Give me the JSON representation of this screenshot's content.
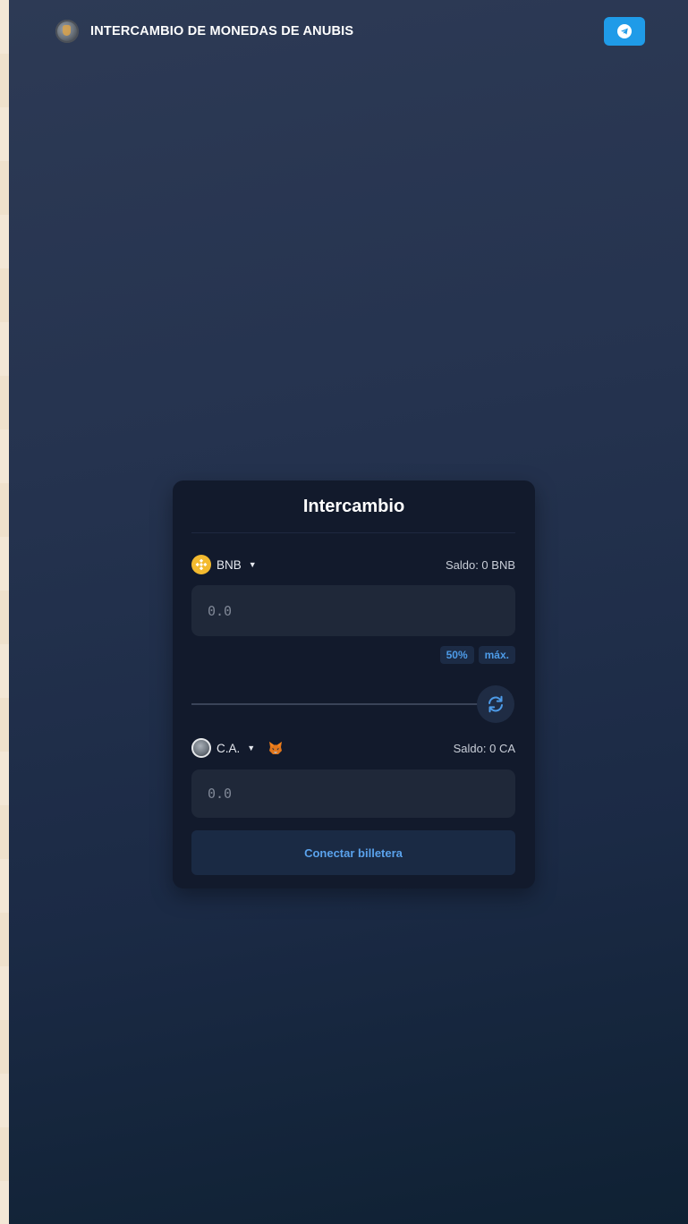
{
  "header": {
    "title": "INTERCAMBIO DE MONEDAS DE ANUBIS"
  },
  "swap": {
    "title": "Intercambio",
    "from": {
      "symbol": "BNB",
      "balance": "Saldo: 0 BNB",
      "placeholder": "0.0"
    },
    "percent_buttons": [
      "50%",
      "máx."
    ],
    "to": {
      "symbol": "C.A.",
      "balance": "Saldo: 0 CA",
      "placeholder": "0.0"
    },
    "connect_label": "Conectar billetera"
  },
  "colors": {
    "accent": "#1f9be8",
    "link_blue": "#5aa2ec",
    "bnb_yellow": "#f3ba2f",
    "card_bg": "#121a2c",
    "input_bg": "#1f2839"
  },
  "icons": {
    "brand": "anubis-logo-icon",
    "telegram": "telegram-icon",
    "from_token": "bnb-icon",
    "to_token": "ca-token-icon",
    "wallet": "metamask-fox-icon",
    "swap": "swap-arrows-icon"
  }
}
